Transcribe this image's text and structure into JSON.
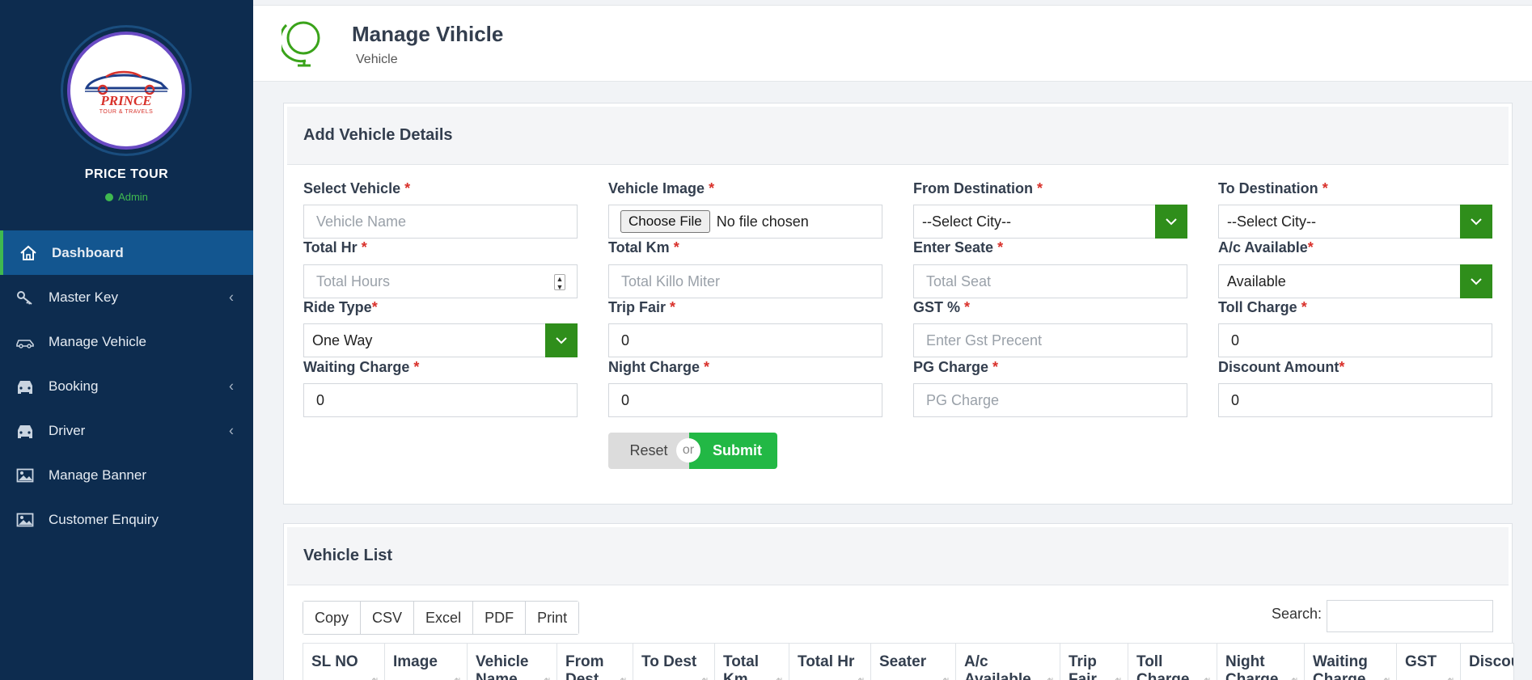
{
  "sidebar": {
    "brand_name": "PRICE TOUR",
    "role": "Admin",
    "logo_text": "PRINCE",
    "logo_subtext": "TOUR & TRAVELS",
    "items": [
      {
        "label": "Dashboard",
        "icon": "home-icon",
        "active": true,
        "has_submenu": false
      },
      {
        "label": "Master Key",
        "icon": "key-icon",
        "active": false,
        "has_submenu": true
      },
      {
        "label": "Manage Vehicle",
        "icon": "car-icon",
        "active": false,
        "has_submenu": false
      },
      {
        "label": "Booking",
        "icon": "car-front-icon",
        "active": false,
        "has_submenu": true
      },
      {
        "label": "Driver",
        "icon": "car-front-icon",
        "active": false,
        "has_submenu": true
      },
      {
        "label": "Manage Banner",
        "icon": "image-icon",
        "active": false,
        "has_submenu": false
      },
      {
        "label": "Customer Enquiry",
        "icon": "image-icon",
        "active": false,
        "has_submenu": false
      }
    ]
  },
  "header": {
    "title": "Manage Vihicle",
    "subtitle": "Vehicle",
    "icon": "globe-icon"
  },
  "form": {
    "title": "Add Vehicle Details",
    "fields": {
      "select_vehicle": {
        "label": "Select Vehicle",
        "placeholder": "Vehicle Name"
      },
      "vehicle_image": {
        "label": "Vehicle Image",
        "button": "Choose File",
        "value": "No file chosen"
      },
      "from_destination": {
        "label": "From Destination",
        "value": "--Select City--"
      },
      "to_destination": {
        "label": "To Destination",
        "value": "--Select City--"
      },
      "total_hr": {
        "label": "Total Hr",
        "placeholder": "Total Hours"
      },
      "total_km": {
        "label": "Total Km",
        "placeholder": "Total Killo Miter"
      },
      "enter_seate": {
        "label": "Enter Seate",
        "placeholder": "Total Seat"
      },
      "ac_available": {
        "label": "A/c Available",
        "value": "Available"
      },
      "ride_type": {
        "label": "Ride Type",
        "value": "One Way"
      },
      "trip_fair": {
        "label": "Trip Fair",
        "value": "0"
      },
      "gst": {
        "label": "GST %",
        "placeholder": "Enter Gst Precent"
      },
      "toll_charge": {
        "label": "Toll Charge",
        "value": "0"
      },
      "waiting_charge": {
        "label": "Waiting Charge",
        "value": "0"
      },
      "night_charge": {
        "label": "Night Charge",
        "value": "0"
      },
      "pg_charge": {
        "label": "PG Charge",
        "placeholder": "PG Charge"
      },
      "discount_amount": {
        "label": "Discount Amount",
        "value": "0"
      }
    },
    "required_mark": "*",
    "reset_label": "Reset",
    "or_label": "or",
    "submit_label": "Submit"
  },
  "list": {
    "title": "Vehicle List",
    "export_buttons": [
      "Copy",
      "CSV",
      "Excel",
      "PDF",
      "Print"
    ],
    "search_label": "Search:",
    "columns": [
      "SL NO",
      "Image",
      "Vehicle Name",
      "From Dest",
      "To Dest",
      "Total Km",
      "Total Hr",
      "Seater",
      "A/c Available",
      "Trip Fair",
      "Toll Charge",
      "Night Charge",
      "Waiting Charge",
      "GST",
      "Discount"
    ]
  },
  "colors": {
    "sidebar_bg": "#0d2c4f",
    "active_item_bg": "#135690",
    "accent_green": "#2f8e1b",
    "submit_green": "#22b845",
    "required_red": "#d9312b"
  }
}
